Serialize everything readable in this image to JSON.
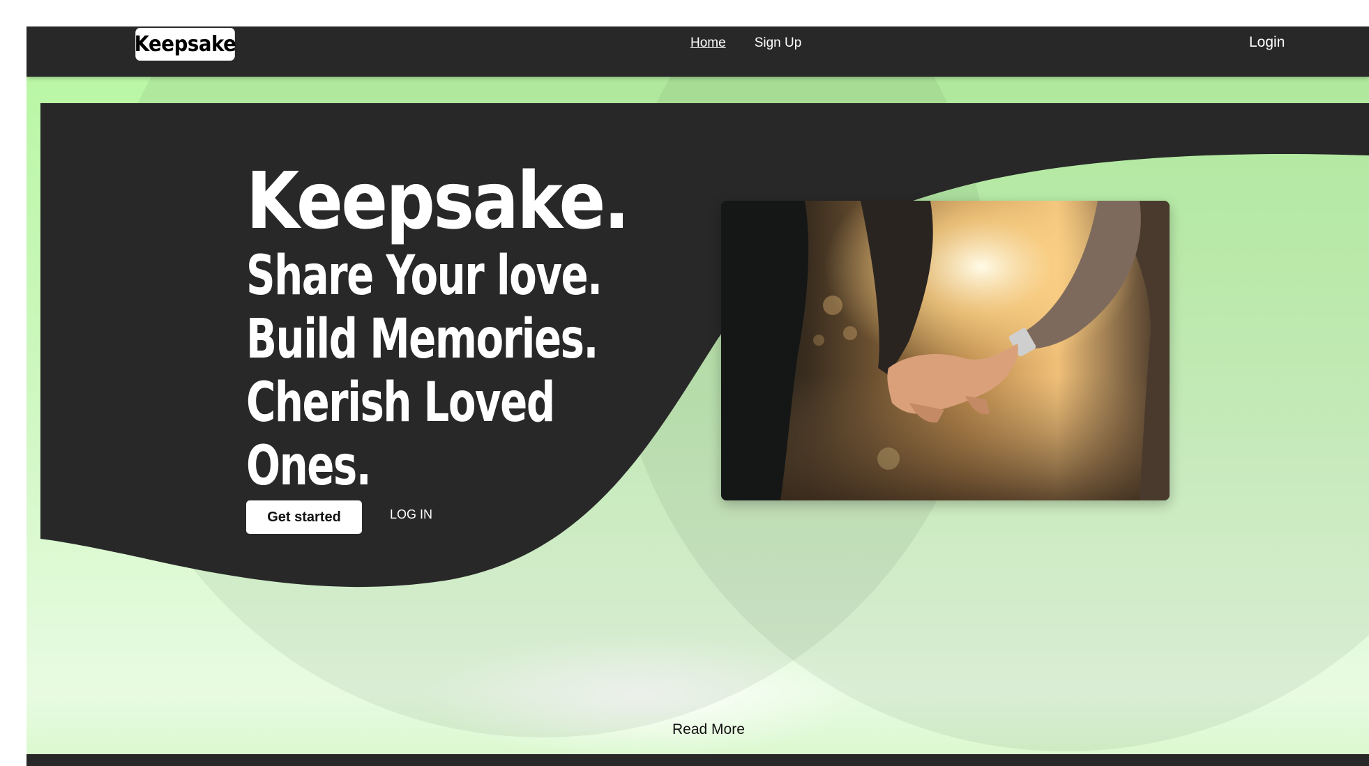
{
  "navbar": {
    "logo_text": "Keepsake",
    "links": [
      {
        "label": "Home",
        "active": true
      },
      {
        "label": "Sign Up",
        "active": false
      }
    ],
    "login_label": "Login"
  },
  "hero": {
    "brand": "Keepsake.",
    "tagline": "Share Your love. Build Memories. Cherish Loved Ones.",
    "get_started_label": "Get started",
    "login_label": "LOG IN",
    "image_icon": "couple-holding-hands-photo"
  },
  "footer_link": {
    "read_more_label": "Read More"
  },
  "colors": {
    "dark": "#282828",
    "accent_green": "#b7f7a2",
    "white": "#ffffff"
  }
}
